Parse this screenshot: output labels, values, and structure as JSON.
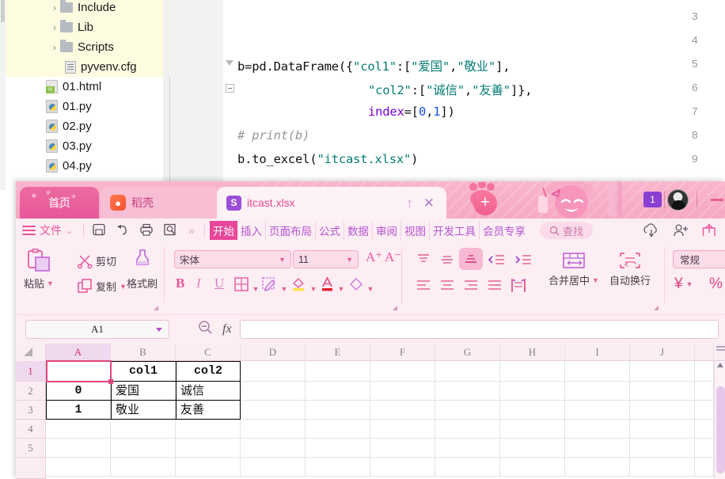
{
  "ide": {
    "tree": {
      "items": [
        {
          "label": "Include",
          "icon": "folder-icon",
          "chevron": "›",
          "indent": 62,
          "highlight": true
        },
        {
          "label": "Lib",
          "icon": "folder-icon",
          "chevron": "›",
          "indent": 62,
          "highlight": true
        },
        {
          "label": "Scripts",
          "icon": "folder-icon",
          "chevron": "›",
          "indent": 62,
          "highlight": true
        },
        {
          "label": "pyvenv.cfg",
          "icon": "config-file-icon",
          "chevron": "",
          "indent": 76,
          "highlight": true
        },
        {
          "label": "01.html",
          "icon": "html-file-icon",
          "chevron": "",
          "indent": 56,
          "highlight": false
        },
        {
          "label": "01.py",
          "icon": "python-file-icon",
          "chevron": "",
          "indent": 56,
          "highlight": false
        },
        {
          "label": "02.py",
          "icon": "python-file-icon",
          "chevron": "",
          "indent": 56,
          "highlight": false
        },
        {
          "label": "03.py",
          "icon": "python-file-icon",
          "chevron": "",
          "indent": 56,
          "highlight": false
        },
        {
          "label": "04.py",
          "icon": "python-file-icon",
          "chevron": "",
          "indent": 56,
          "highlight": false
        }
      ]
    },
    "editor": {
      "line_numbers": [
        "3",
        "4",
        "5",
        "6",
        "7",
        "8",
        "9"
      ],
      "code": {
        "l5_a": "b=pd.DataFrame({",
        "l5_b": "\"col1\"",
        "l5_c": ":[",
        "l5_d": "\"爱国\"",
        "l5_e": ",",
        "l5_f": "\"敬业\"",
        "l5_g": "],",
        "l6_b": "\"col2\"",
        "l6_c": ":[",
        "l6_d": "\"诚信\"",
        "l6_e": ",",
        "l6_f": "\"友善\"",
        "l6_g": "]},",
        "l7_a": "index",
        "l7_b": "=[",
        "l7_c": "0",
        "l7_d": ",",
        "l7_e": "1",
        "l7_f": "])",
        "l8": "# print(b)",
        "l9_a": "b.to_excel(",
        "l9_b": "\"itcast.xlsx\"",
        "l9_c": ")"
      }
    }
  },
  "wps": {
    "titlebar": {
      "tabs": [
        {
          "label": "首页",
          "icon": ""
        },
        {
          "label": "稻壳",
          "icon": "docer-icon"
        },
        {
          "label": "itcast.xlsx",
          "icon": "xlsx-file-icon"
        }
      ],
      "tab_up_icon": "↑",
      "tab_close_icon": "✕",
      "new_tab_icon": "+",
      "notification_badge": "1",
      "minimize_label": "—"
    },
    "menurow": {
      "file_label": "文件",
      "file_caret": "⌄",
      "quick_icons": [
        "save-icon",
        "undo-icon",
        "print-icon",
        "print-preview-icon"
      ],
      "more_icon": "»",
      "ribbon_tabs": [
        {
          "label": "开始",
          "active": true
        },
        {
          "label": "插入",
          "active": false
        },
        {
          "label": "页面布局",
          "active": false
        },
        {
          "label": "公式",
          "active": false
        },
        {
          "label": "数据",
          "active": false
        },
        {
          "label": "审阅",
          "active": false
        },
        {
          "label": "视图",
          "active": false
        },
        {
          "label": "开发工具",
          "active": false
        },
        {
          "label": "会员专享",
          "active": false
        }
      ],
      "find_label": "查找",
      "right_icons": [
        "cloud-sync-icon",
        "add-collaborator-icon",
        "share-icon"
      ]
    },
    "ribbon": {
      "paste_label": "粘贴",
      "cut_label": "剪切",
      "copy_label": "复制",
      "format_painter_label": "格式刷",
      "font_name": "宋体",
      "font_size": "11",
      "grow_font_label": "A⁺",
      "shrink_font_label": "A⁻",
      "bold_label": "B",
      "italic_label": "I",
      "underline_label": "U",
      "border_label": "⌸",
      "merge_center_label": "合并居中",
      "wrap_text_label": "自动换行",
      "number_format": "常规",
      "currency_label": "¥",
      "percent_label": "%"
    },
    "formulabar": {
      "name_box_value": "A1",
      "fx_label": "fx",
      "formula_value": "",
      "zoom_icon": "zoom-out-icon"
    },
    "grid": {
      "columns": [
        "A",
        "B",
        "C",
        "D",
        "E",
        "F",
        "G",
        "H",
        "I",
        "J"
      ],
      "selected_column": "A",
      "rows": [
        "1",
        "2",
        "3",
        "4",
        "5"
      ],
      "selected_row": "1",
      "selected_cell": "A1",
      "cells": [
        {
          "ref": "B1",
          "value": "col1",
          "col": 1,
          "row": 0,
          "style": "header"
        },
        {
          "ref": "C1",
          "value": "col2",
          "col": 2,
          "row": 0,
          "style": "header"
        },
        {
          "ref": "A2",
          "value": "0",
          "col": 0,
          "row": 1,
          "style": "index"
        },
        {
          "ref": "B2",
          "value": "爱国",
          "col": 1,
          "row": 1,
          "style": "text"
        },
        {
          "ref": "C2",
          "value": "诚信",
          "col": 2,
          "row": 1,
          "style": "text"
        },
        {
          "ref": "A3",
          "value": "1",
          "col": 0,
          "row": 2,
          "style": "index"
        },
        {
          "ref": "B3",
          "value": "敬业",
          "col": 1,
          "row": 2,
          "style": "text"
        },
        {
          "ref": "C3",
          "value": "友善",
          "col": 2,
          "row": 2,
          "style": "text"
        }
      ]
    }
  },
  "colors": {
    "accent_pink": "#e8469a",
    "title_bar": "#f7aec7",
    "ribbon_bg": "#fdeef4",
    "purple_tab": "#b455cf",
    "selection_border": "#e0457f",
    "code_string": "#067d74",
    "code_keyword": "#7a00cc",
    "code_number": "#1750eb",
    "code_comment": "#969696"
  }
}
